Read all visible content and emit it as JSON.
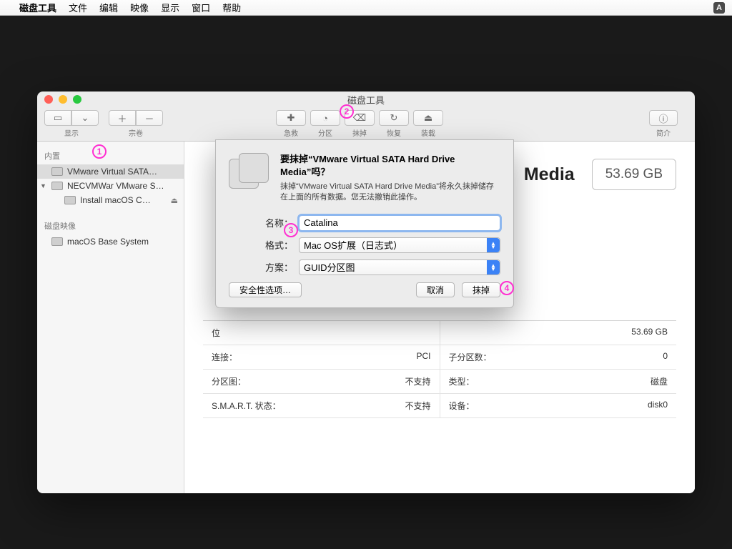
{
  "menubar": {
    "app": "磁盘工具",
    "items": [
      "文件",
      "编辑",
      "映像",
      "显示",
      "窗口",
      "帮助"
    ],
    "ime": "A"
  },
  "window": {
    "title": "磁盘工具",
    "toolbar": {
      "view_label": "显示",
      "volume_label": "宗卷",
      "firstaid": "急救",
      "partition": "分区",
      "erase": "抹掉",
      "restore": "恢复",
      "mount": "装载",
      "info": "简介"
    },
    "sidebar": {
      "internal": "内置",
      "items": [
        {
          "label": "VMware Virtual SATA…"
        },
        {
          "label": "NECVMWar VMware S…"
        },
        {
          "label": "Install macOS C…"
        }
      ],
      "images_header": "磁盘映像",
      "images": [
        {
          "label": "macOS Base System"
        }
      ]
    },
    "main": {
      "title_suffix": "Media",
      "capacity": "53.69 GB",
      "rows": [
        {
          "l_key": "位",
          "l_val": "",
          "r_key": "",
          "r_val": "53.69 GB"
        },
        {
          "l_key": "连接：",
          "l_val": "PCI",
          "r_key": "子分区数：",
          "r_val": "0"
        },
        {
          "l_key": "分区图：",
          "l_val": "不支持",
          "r_key": "类型：",
          "r_val": "磁盘"
        },
        {
          "l_key": "S.M.A.R.T. 状态：",
          "l_val": "不支持",
          "r_key": "设备：",
          "r_val": "disk0"
        }
      ]
    }
  },
  "sheet": {
    "heading": "要抹掉“VMware Virtual SATA Hard Drive Media”吗？",
    "desc": "抹掉“VMware Virtual SATA Hard Drive Media”将永久抹掉储存在上面的所有数据。您无法撤销此操作。",
    "name_label": "名称：",
    "name_value": "Catalina",
    "format_label": "格式：",
    "format_value": "Mac OS扩展（日志式）",
    "scheme_label": "方案：",
    "scheme_value": "GUID分区图",
    "security": "安全性选项…",
    "cancel": "取消",
    "erase": "抹掉"
  },
  "annotations": {
    "a1": "1",
    "a2": "2",
    "a3": "3",
    "a4": "4"
  }
}
